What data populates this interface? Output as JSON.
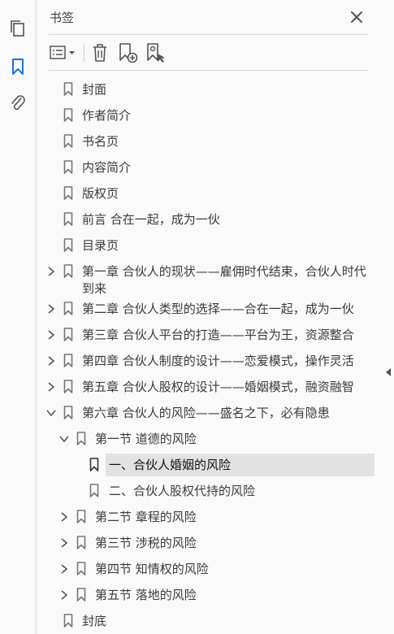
{
  "panel": {
    "title": "书签"
  },
  "colors": {
    "accent": "#1473e6",
    "icon": "#555555",
    "selected_bg": "#e2e2e2"
  },
  "sidebar_icons": [
    "pages-icon",
    "bookmark-icon",
    "attachment-icon"
  ],
  "toolbar": [
    "options-menu-icon",
    "delete-icon",
    "add-bookmark-icon",
    "new-bookmark-from-structure-icon"
  ],
  "bookmarks": [
    {
      "label": "封面"
    },
    {
      "label": "作者简介"
    },
    {
      "label": "书名页"
    },
    {
      "label": "内容简介"
    },
    {
      "label": "版权页"
    },
    {
      "label": "前言  合在一起，成为一伙"
    },
    {
      "label": "目录页"
    },
    {
      "label": "第一章  合伙人的现状——雇佣时代结束，合伙人时代到来"
    },
    {
      "label": "第二章  合伙人类型的选择——合在一起，成为一伙"
    },
    {
      "label": "第三章  合伙人平台的打造——平台为王，资源整合"
    },
    {
      "label": "第四章  合伙人制度的设计——恋爱模式，操作灵活"
    },
    {
      "label": "第五章  合伙人股权的设计——婚姻模式，融资融智"
    },
    {
      "label": "第六章  合伙人的风险——盛名之下，必有隐患"
    },
    {
      "label": "第一节  道德的风险"
    },
    {
      "label": "一、合伙人婚姻的风险"
    },
    {
      "label": "二、合伙人股权代持的风险"
    },
    {
      "label": "第二节  章程的风险"
    },
    {
      "label": "第三节  涉税的风险"
    },
    {
      "label": "第四节  知情权的风险"
    },
    {
      "label": "第五节  落地的风险"
    },
    {
      "label": "封底"
    }
  ]
}
